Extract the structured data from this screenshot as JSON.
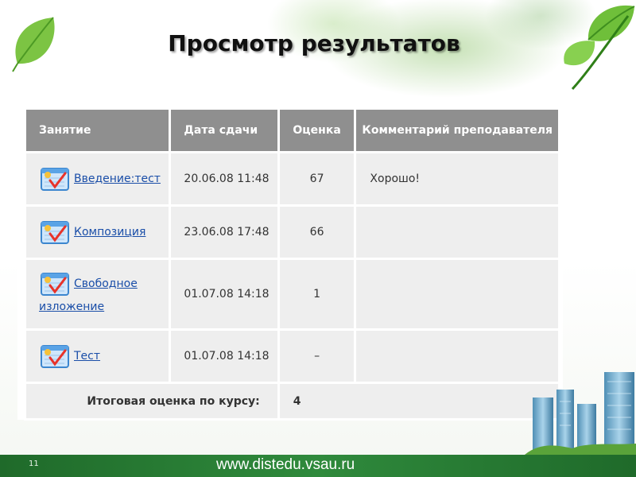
{
  "slide": {
    "title": "Просмотр результатов",
    "page_number": "11",
    "site_url": "www.distedu.vsau.ru"
  },
  "table": {
    "headers": [
      "Занятие",
      "Дата сдачи",
      "Оценка",
      "Комментарий преподавателя"
    ],
    "rows": [
      {
        "lesson": "Введение:тест",
        "date": "20.06.08 11:48",
        "grade": "67",
        "comment": "Хорошо!"
      },
      {
        "lesson": "Композиция",
        "date": "23.06.08 17:48",
        "grade": "66",
        "comment": ""
      },
      {
        "lesson_line1": "Свободное",
        "lesson_line2": "изложение",
        "date": "01.07.08 14:18",
        "grade": "1",
        "comment": ""
      },
      {
        "lesson": "Тест",
        "date": "01.07.08 14:18",
        "grade": "–",
        "comment": ""
      }
    ],
    "total_label": "Итоговая оценка по курсу:",
    "total_value": "4"
  },
  "icons": {
    "lesson": "quiz-checkmark-icon",
    "decor": [
      "leaf-icon",
      "buildings-icon"
    ]
  },
  "colors": {
    "header_bg": "#8f8f8f",
    "cell_bg": "#eeeeee",
    "link": "#1a4ea8",
    "bar": "#2f8a3c"
  }
}
